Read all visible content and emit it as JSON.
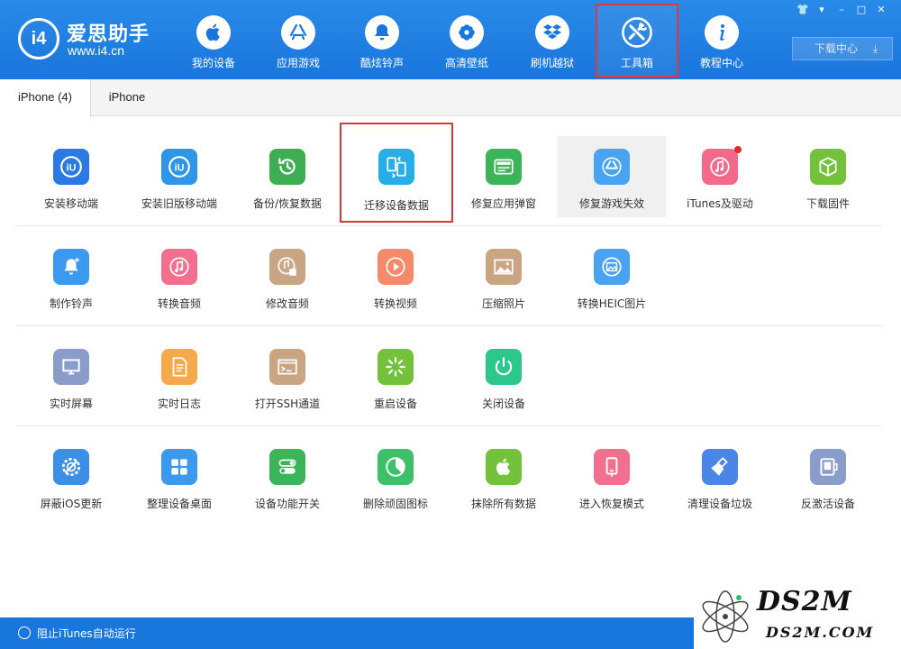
{
  "app": {
    "logo_badge": "i4",
    "logo_name": "爱思助手",
    "logo_url": "www.i4.cn",
    "download_label": "下载中心",
    "nav": [
      {
        "label": "我的设备"
      },
      {
        "label": "应用游戏"
      },
      {
        "label": "酷炫铃声"
      },
      {
        "label": "高清壁纸"
      },
      {
        "label": "刷机越狱"
      },
      {
        "label": "工具箱"
      },
      {
        "label": "教程中心"
      }
    ],
    "window_controls": [
      "shirt",
      "menu",
      "minimize",
      "maximize",
      "close"
    ]
  },
  "tabs": [
    {
      "label": "iPhone (4)"
    },
    {
      "label": "iPhone"
    }
  ],
  "tools": {
    "row1": [
      {
        "label": "安装移动端",
        "color": "#2a7ae2",
        "icon": "i4-icon"
      },
      {
        "label": "安装旧版移动端",
        "color": "#2f95e6",
        "icon": "i4-old-icon"
      },
      {
        "label": "备份/恢复数据",
        "color": "#3dae52",
        "icon": "backup-clock-icon"
      },
      {
        "label": "迁移设备数据",
        "color": "#27aee8",
        "icon": "transfer-phones-icon"
      },
      {
        "label": "修复应用弹窗",
        "color": "#3cb55a",
        "icon": "appleid-card-icon"
      },
      {
        "label": "修复游戏失效",
        "color": "#4aa3f0",
        "icon": "appstore-icon"
      },
      {
        "label": "iTunes及驱动",
        "color": "#f16a8a",
        "icon": "itunes-note-icon"
      },
      {
        "label": "下载固件",
        "color": "#74c23c",
        "icon": "box-icon"
      }
    ],
    "row2": [
      {
        "label": "制作铃声",
        "color": "#3b9af0",
        "icon": "bell-icon"
      },
      {
        "label": "转换音频",
        "color": "#f2708e",
        "icon": "music-note-icon"
      },
      {
        "label": "修改音频",
        "color": "#c9a584",
        "icon": "music-edit-icon"
      },
      {
        "label": "转换视频",
        "color": "#f58a6a",
        "icon": "video-play-icon"
      },
      {
        "label": "压缩照片",
        "color": "#c9a584",
        "icon": "photo-icon"
      },
      {
        "label": "转换HEIC图片",
        "color": "#4aa3f0",
        "icon": "heic-icon"
      }
    ],
    "row3": [
      {
        "label": "实时屏幕",
        "color": "#8a9cc9",
        "icon": "monitor-icon"
      },
      {
        "label": "实时日志",
        "color": "#f5a94a",
        "icon": "log-doc-icon"
      },
      {
        "label": "打开SSH通道",
        "color": "#c9a584",
        "icon": "terminal-icon"
      },
      {
        "label": "重启设备",
        "color": "#74c23c",
        "icon": "restart-spinner-icon"
      },
      {
        "label": "关闭设备",
        "color": "#2cc78a",
        "icon": "power-icon"
      }
    ],
    "row4": [
      {
        "label": "屏蔽iOS更新",
        "color": "#3b8fe6",
        "icon": "gear-block-icon"
      },
      {
        "label": "整理设备桌面",
        "color": "#3b9af0",
        "icon": "grid-icon"
      },
      {
        "label": "设备功能开关",
        "color": "#3cb55a",
        "icon": "toggle-icon"
      },
      {
        "label": "删除顽固图标",
        "color": "#3cc06a",
        "icon": "pie-icon"
      },
      {
        "label": "抹除所有数据",
        "color": "#74c23c",
        "icon": "apple-icon"
      },
      {
        "label": "进入恢复模式",
        "color": "#f2708e",
        "icon": "phone-recovery-icon"
      },
      {
        "label": "清理设备垃圾",
        "color": "#4a86e8",
        "icon": "broom-icon"
      },
      {
        "label": "反激活设备",
        "color": "#8a9cc9",
        "icon": "deactivate-icon"
      }
    ]
  },
  "status": {
    "text": "阻止iTunes自动运行"
  },
  "watermark": {
    "big": "DS2M",
    "small": "DS2M.COM"
  }
}
